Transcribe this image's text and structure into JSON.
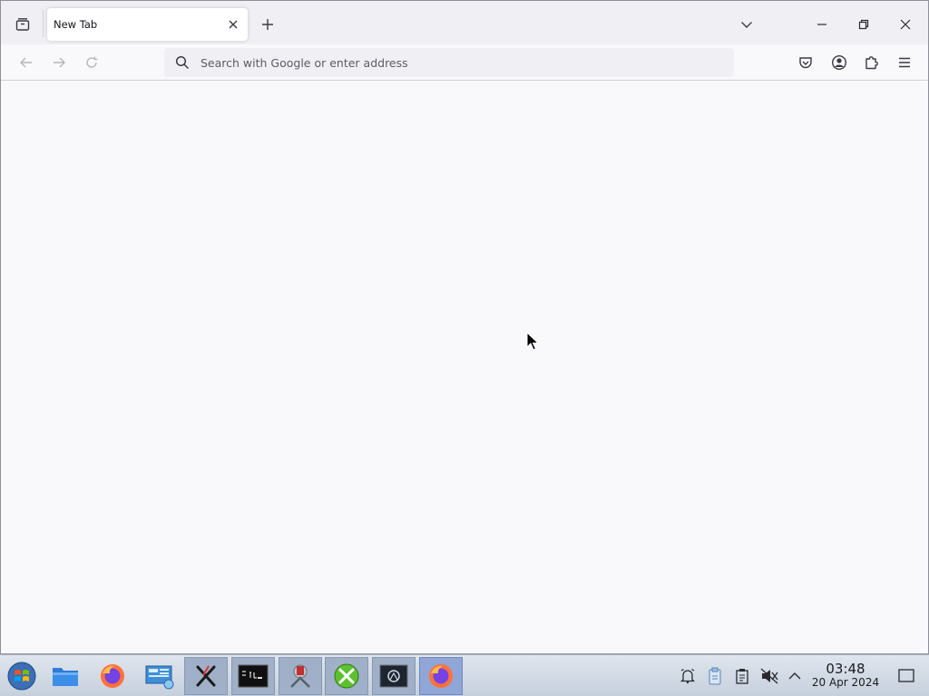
{
  "browser": {
    "tab": {
      "title": "New Tab"
    },
    "urlbar": {
      "placeholder": "Search with Google or enter address",
      "value": ""
    }
  },
  "taskbar": {
    "apps": [
      {
        "name": "start-menu-icon"
      },
      {
        "name": "file-manager-icon"
      },
      {
        "name": "firefox-icon"
      },
      {
        "name": "remote-desktop-icon"
      },
      {
        "name": "x-tool-icon"
      },
      {
        "name": "terminal-icon"
      },
      {
        "name": "system-tool-icon"
      },
      {
        "name": "settings-tools-icon"
      },
      {
        "name": "screenshot-app-icon"
      },
      {
        "name": "firefox-icon"
      }
    ],
    "clock": {
      "time": "03:48",
      "date": "20 Apr 2024"
    }
  },
  "colors": {
    "tab_strip": "#f0f0f4",
    "content_background": "#f9f9fb",
    "taskbar_active": "#8fa6d6",
    "firefox_orange": "#ff7139"
  }
}
